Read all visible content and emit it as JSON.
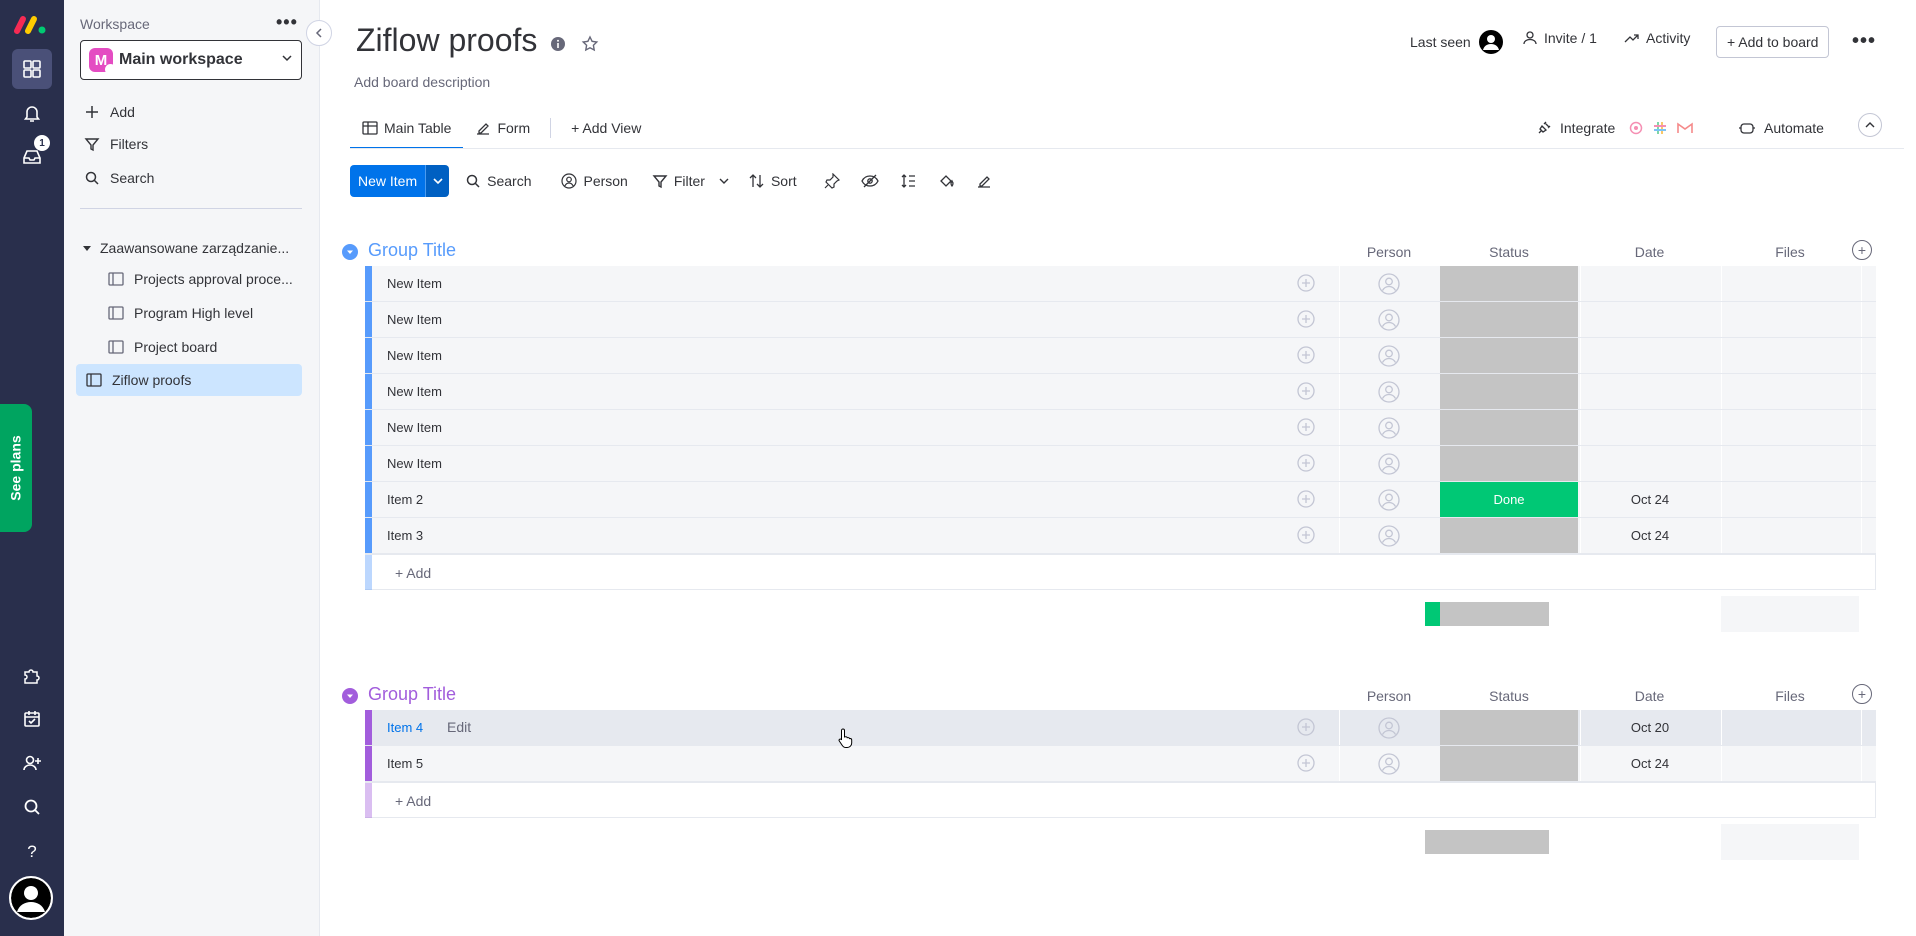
{
  "sidebar": {
    "workspace_label": "Workspace",
    "workspace_initial": "M",
    "workspace_name": "Main workspace",
    "add_label": "Add",
    "filters_label": "Filters",
    "search_label": "Search",
    "folder_name": "Zaawansowane zarządzanie...",
    "boards": [
      "Projects approval proce...",
      "Program High level",
      "Project board"
    ],
    "active_board": "Ziflow proofs",
    "inbox_badge": "1",
    "see_plans": "See plans"
  },
  "board": {
    "title": "Ziflow proofs",
    "description": "Add board description",
    "last_seen": "Last seen",
    "invite": "Invite / 1",
    "activity": "Activity",
    "add_to_board": "+ Add to board"
  },
  "tabs": {
    "main_table": "Main Table",
    "form": "Form",
    "add_view": "+ Add View",
    "integrate": "Integrate",
    "automate": "Automate"
  },
  "toolbar": {
    "new_item": "New Item",
    "search": "Search",
    "person": "Person",
    "filter": "Filter",
    "sort": "Sort"
  },
  "columns": {
    "person": "Person",
    "status": "Status",
    "date": "Date",
    "files": "Files"
  },
  "colors": {
    "group1": "#579bfc",
    "group2": "#a25ddc",
    "done": "#00c875",
    "empty_status": "#c4c4c4"
  },
  "groups": [
    {
      "title": "Group Title",
      "add_label": "+ Add",
      "rows": [
        {
          "name": "New Item",
          "status": "",
          "date": ""
        },
        {
          "name": "New Item",
          "status": "",
          "date": ""
        },
        {
          "name": "New Item",
          "status": "",
          "date": ""
        },
        {
          "name": "New Item",
          "status": "",
          "date": ""
        },
        {
          "name": "New Item",
          "status": "",
          "date": ""
        },
        {
          "name": "New Item",
          "status": "",
          "date": ""
        },
        {
          "name": "Item 2",
          "status": "Done",
          "date": "Oct 24"
        },
        {
          "name": "Item 3",
          "status": "",
          "date": "Oct 24"
        }
      ]
    },
    {
      "title": "Group Title",
      "add_label": "+ Add",
      "rows": [
        {
          "name": "Item 4",
          "status": "",
          "date": "Oct 20",
          "edit": "Edit"
        },
        {
          "name": "Item 5",
          "status": "",
          "date": "Oct 24"
        }
      ]
    }
  ]
}
